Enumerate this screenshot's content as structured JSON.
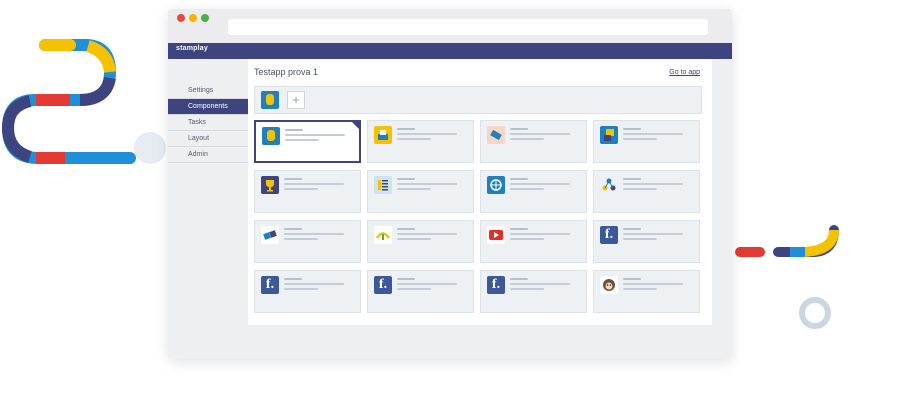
{
  "window": {
    "brand": "stamplay"
  },
  "sidebar": {
    "items": [
      {
        "label": "Settings",
        "active": false
      },
      {
        "label": "Components",
        "active": true
      },
      {
        "label": "Tasks",
        "active": false
      },
      {
        "label": "Layout",
        "active": false
      },
      {
        "label": "Admin",
        "active": false
      }
    ]
  },
  "main": {
    "title": "Testapp prova 1",
    "goto_link": "Go to app",
    "add_button": "+",
    "components": [
      {
        "icon": "robot-icon",
        "selected": true
      },
      {
        "icon": "folder-icon"
      },
      {
        "icon": "ticket-icon"
      },
      {
        "icon": "image-icon"
      },
      {
        "icon": "trophy-icon"
      },
      {
        "icon": "list-icon"
      },
      {
        "icon": "globe-icon"
      },
      {
        "icon": "share-icon"
      },
      {
        "icon": "tag-icon"
      },
      {
        "icon": "recycle-icon"
      },
      {
        "icon": "youtube-icon"
      },
      {
        "icon": "facebook-icon",
        "glyph": "f."
      },
      {
        "icon": "facebook-icon",
        "glyph": "f."
      },
      {
        "icon": "facebook-icon",
        "glyph": "f."
      },
      {
        "icon": "facebook-icon",
        "glyph": "f."
      },
      {
        "icon": "mailchimp-icon"
      }
    ]
  },
  "colors": {
    "primary": "#3e4480",
    "tile_bg": "#edf1f4",
    "pipe_navy": "#3e4480",
    "pipe_blue": "#1e8fd8",
    "pipe_yellow": "#f5c200",
    "pipe_red": "#e53935"
  }
}
